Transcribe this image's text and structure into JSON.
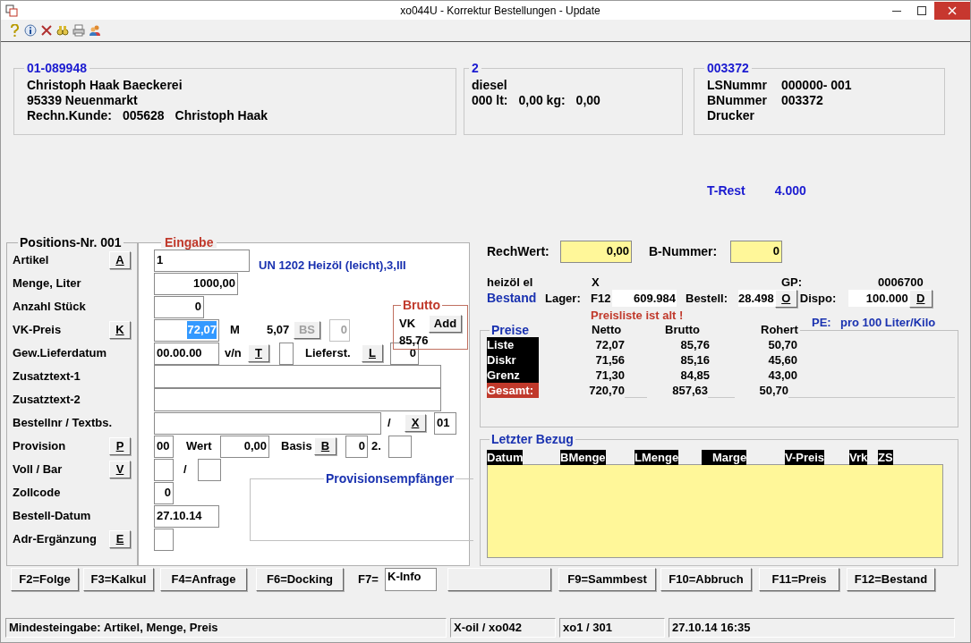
{
  "window": {
    "title": "xo044U - Korrektur Bestellungen - Update"
  },
  "customer": {
    "legend": "01-089948",
    "lines": [
      [
        "Christoph Haak Baeckerei"
      ],
      [
        "95339 Neuenmarkt"
      ],
      [
        "Rechn.Kunde:",
        "005628",
        "Christoph Haak"
      ]
    ]
  },
  "product": {
    "legend": "2",
    "lines": [
      [
        "diesel"
      ],
      [
        "000 lt:",
        "0,00 kg:",
        "0,00"
      ]
    ]
  },
  "delivery": {
    "legend": "003372",
    "lines": [
      [
        "LSNummr",
        "000000- 001"
      ],
      [
        "BNummer",
        "003372"
      ],
      [
        "Drucker"
      ]
    ]
  },
  "t_rest": {
    "label": "T-Rest",
    "value": "4.000"
  },
  "positions": {
    "legend": "Positions-Nr. 001",
    "fields": [
      {
        "label": "Artikel",
        "key": "A"
      },
      {
        "label": "Menge, Liter"
      },
      {
        "label": "Anzahl Stück"
      },
      {
        "label": "VK-Preis",
        "key": "K"
      },
      {
        "label": "Gew.Lieferdatum"
      },
      {
        "label": "Zusatztext-1"
      },
      {
        "label": "Zusatztext-2"
      },
      {
        "label": "Bestellnr / Textbs."
      },
      {
        "label": "Provision",
        "key": "P"
      },
      {
        "label": "Voll / Bar",
        "key": "V"
      },
      {
        "label": "Zollcode"
      },
      {
        "label": "Bestell-Datum"
      },
      {
        "label": "Adr-Ergänzung",
        "key": "E"
      }
    ]
  },
  "entry": {
    "legend": "Eingabe",
    "artikel": {
      "value": "1",
      "description": "UN 1202 Heizöl (leicht),3,III"
    },
    "menge": "1000,00",
    "anzahl": "0",
    "vk": {
      "value": "72,07",
      "selected": true,
      "m_label": "M",
      "m_value": "5,07",
      "bs_button": "BS",
      "bs_disabled": true,
      "bs_value": "0"
    },
    "brutto": {
      "legend": "Brutto",
      "label": "VK",
      "add_button": "Add",
      "value": "85,76"
    },
    "lieferdatum": {
      "value": "00.00.00",
      "vn_label": "v/n",
      "t_button": "T",
      "lieferst_label": "Lieferst.",
      "l_button": "L",
      "lieferst_value": "0"
    },
    "bestellnr": {
      "separator": "/",
      "x_button": "X",
      "suffix": "01"
    },
    "provision": {
      "value": "00",
      "wert_label": "Wert",
      "wert": "0,00",
      "basis_label": "Basis",
      "b_button": "B",
      "basis": "0",
      "second_label": "2."
    },
    "voll_bar": {
      "separator": "/"
    },
    "empfaenger": {
      "legend": "Provisionsempfänger"
    },
    "zollcode": "0",
    "bestell_datum": "27.10.14"
  },
  "rechwert": {
    "label": "RechWert:",
    "value": "0,00"
  },
  "b_nummer": {
    "label": "B-Nummer:",
    "value": "0"
  },
  "stock": {
    "product": "heizöl el",
    "flag": "X",
    "gp_label": "GP:",
    "gp": "0006700",
    "bestand_label": "Bestand",
    "lager_label": "Lager:",
    "lager": "F12",
    "lager_value": "609.984",
    "bestell_label": "Bestell:",
    "bestell": "28.498",
    "o_button": "O",
    "dispo_label": "Dispo:",
    "dispo": "100.000",
    "d_button": "D",
    "warning": "Preisliste ist alt !",
    "pe_label": "PE:",
    "pe": "pro 100 Liter/Kilo"
  },
  "prices": {
    "legend": "Preise",
    "columns": [
      "Netto",
      "Brutto",
      "Rohert"
    ],
    "rows": [
      {
        "label": "Liste",
        "values": [
          "72,07",
          "85,76",
          "50,70"
        ]
      },
      {
        "label": "Diskr",
        "values": [
          "71,56",
          "85,16",
          "45,60"
        ]
      },
      {
        "label": "Grenz",
        "values": [
          "71,30",
          "84,85",
          "43,00"
        ]
      }
    ],
    "total": {
      "label": "Gesamt:",
      "values": [
        "720,70",
        "857,63",
        "50,70"
      ]
    }
  },
  "history": {
    "legend": "Letzter Bezug",
    "columns": [
      "Datum",
      "BMenge",
      "LMenge",
      "Marge",
      "V-Preis",
      "Vrk",
      "ZS"
    ]
  },
  "function_keys": [
    {
      "kind": "button",
      "label": "F2=Folge"
    },
    {
      "kind": "button",
      "label": "F3=Kalkul"
    },
    {
      "kind": "button",
      "label": "F4=Anfrage"
    },
    {
      "kind": "button",
      "label": "F6=Docking"
    },
    {
      "kind": "field",
      "label": "F7=",
      "value": "K-Info"
    },
    {
      "kind": "blank"
    },
    {
      "kind": "button",
      "label": "F9=Sammbest"
    },
    {
      "kind": "button",
      "label": "F10=Abbruch"
    },
    {
      "kind": "button",
      "label": "F11=Preis"
    },
    {
      "kind": "button",
      "label": "F12=Bestand"
    }
  ],
  "status_bar": [
    "Mindesteingabe: Artikel, Menge, Preis",
    "X-oil / xo042",
    "xo1 / 301",
    "27.10.14 16:35"
  ]
}
